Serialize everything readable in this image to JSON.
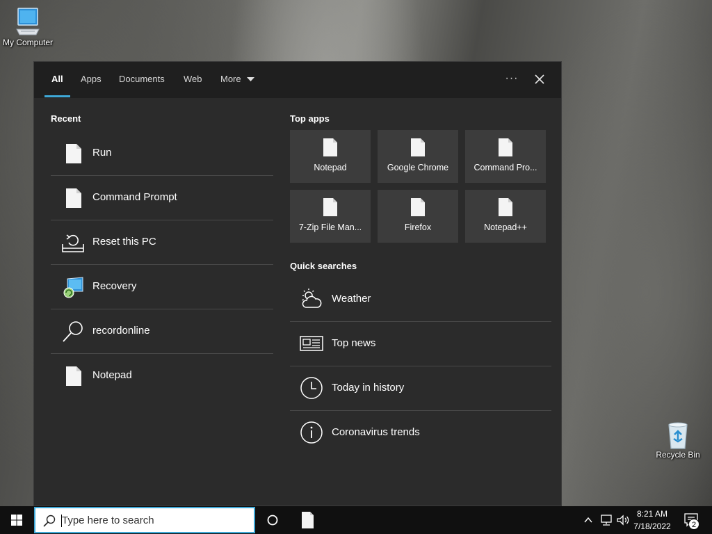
{
  "desktop": {
    "icons": [
      {
        "label": "My Computer",
        "icon": "monitor-icon"
      },
      {
        "label": "Recycle Bin",
        "icon": "recycle-bin-icon"
      }
    ]
  },
  "search_panel": {
    "tabs": [
      {
        "label": "All",
        "active": true
      },
      {
        "label": "Apps"
      },
      {
        "label": "Documents"
      },
      {
        "label": "Web"
      },
      {
        "label": "More"
      }
    ],
    "options_icon": "ellipsis-icon",
    "close_icon": "close-icon",
    "recent": {
      "title": "Recent",
      "items": [
        {
          "label": "Run",
          "icon": "document-icon"
        },
        {
          "label": "Command Prompt",
          "icon": "document-icon"
        },
        {
          "label": "Reset this PC",
          "icon": "reset-pc-icon"
        },
        {
          "label": "Recovery",
          "icon": "recovery-icon"
        },
        {
          "label": "recordonline",
          "icon": "search-icon"
        },
        {
          "label": "Notepad",
          "icon": "document-icon"
        }
      ]
    },
    "top_apps": {
      "title": "Top apps",
      "items": [
        {
          "label": "Notepad"
        },
        {
          "label": "Google Chrome"
        },
        {
          "label": "Command Pro..."
        },
        {
          "label": "7-Zip File Man..."
        },
        {
          "label": "Firefox"
        },
        {
          "label": "Notepad++"
        }
      ]
    },
    "quick_searches": {
      "title": "Quick searches",
      "items": [
        {
          "label": "Weather",
          "icon": "weather-icon"
        },
        {
          "label": "Top news",
          "icon": "news-icon"
        },
        {
          "label": "Today in history",
          "icon": "clock-icon"
        },
        {
          "label": "Coronavirus trends",
          "icon": "info-icon"
        }
      ]
    }
  },
  "taskbar": {
    "search_placeholder": "Type here to search",
    "clock_time": "8:21 AM",
    "clock_date": "7/18/2022",
    "notification_count": "2"
  },
  "colors": {
    "accent": "#3fa9d8",
    "panel_bg": "#2b2b2b",
    "tab_bar_bg": "#1f1f1f",
    "tile_bg": "#3c3c3c",
    "taskbar_bg": "#101010"
  }
}
